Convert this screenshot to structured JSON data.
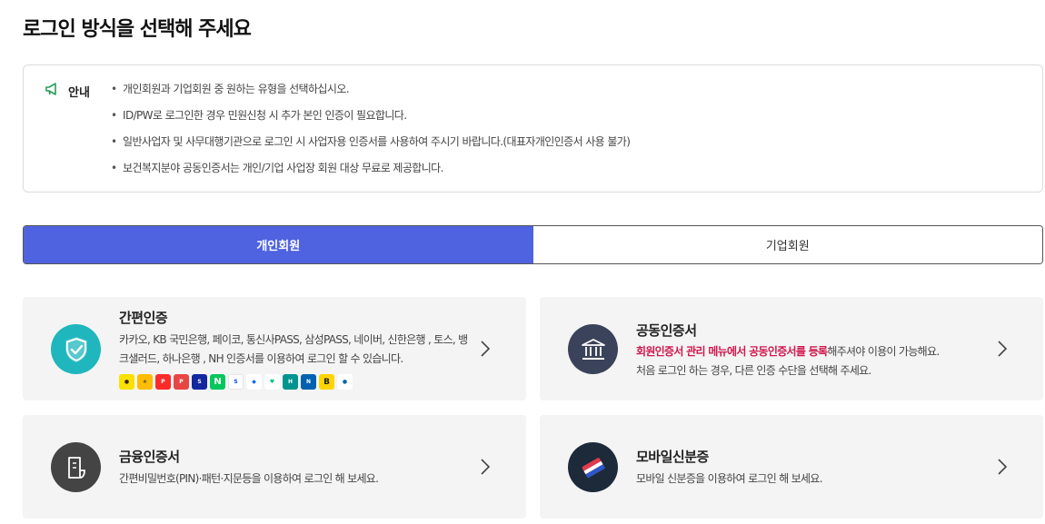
{
  "page": {
    "title": "로그인 방식을 선택해 주세요"
  },
  "notice": {
    "label": "안내",
    "items": [
      "개인회원과 기업회원 중 원하는 유형을 선택하십시오.",
      "ID/PW로 로그인한 경우 민원신청 시 추가 본인 인증이 필요합니다.",
      "일반사업자 및 사무대행기관으로 로그인 시 사업자용 인증서를 사용하여 주시기 바랍니다.(대표자개인인증서 사용 불가)",
      "보건복지분야 공동인증서는 개인/기업 사업장 회원 대상 무료로 제공합니다."
    ]
  },
  "tabs": {
    "personal": "개인회원",
    "corporate": "기업회원",
    "active": "personal"
  },
  "cards": {
    "simple": {
      "title": "간편인증",
      "desc_line1": "카카오, KB 국민은행, 페이코, 통신사PASS, 삼성PASS, 네이버, 신한은행 , 토스, 뱅",
      "desc_line2": "크샐러드, 하나은행 , NH 인증서를 이용하여 로그인 할 수 있습니다.",
      "icon": "shield-check-icon",
      "color": "#1fb6bd",
      "providers": [
        "kakao",
        "kb",
        "payco",
        "pass",
        "samsung-pass",
        "naver",
        "shinhan",
        "toss",
        "banksalad",
        "hana",
        "nh",
        "b-cert",
        "woori"
      ]
    },
    "joint": {
      "title": "공동인증서",
      "desc_red": "회원인증서 관리 메뉴에서 공동인증서를 등록",
      "desc_rest": "해주셔야 이용이 가능해요.",
      "desc_line2": "처음 로그인 하는 경우, 다른 인증 수단을 선택해 주세요.",
      "icon": "bank-building-icon",
      "color": "#3a4359"
    },
    "financial": {
      "title": "금융인증서",
      "desc_line1": "간편비밀번호(PIN)·패턴·지문등을 이용하여 로그인 해 보세요.",
      "icon": "document-icon",
      "color": "#444444"
    },
    "mobile_id": {
      "title": "모바일신분증",
      "desc_line1": "모바일 신분증을 이용하여 로그인 해 보세요.",
      "icon": "mobile-id-icon",
      "color": "#1c2a3a"
    }
  },
  "colors": {
    "accent": "#4f63e0",
    "highlight": "#d0174c"
  }
}
